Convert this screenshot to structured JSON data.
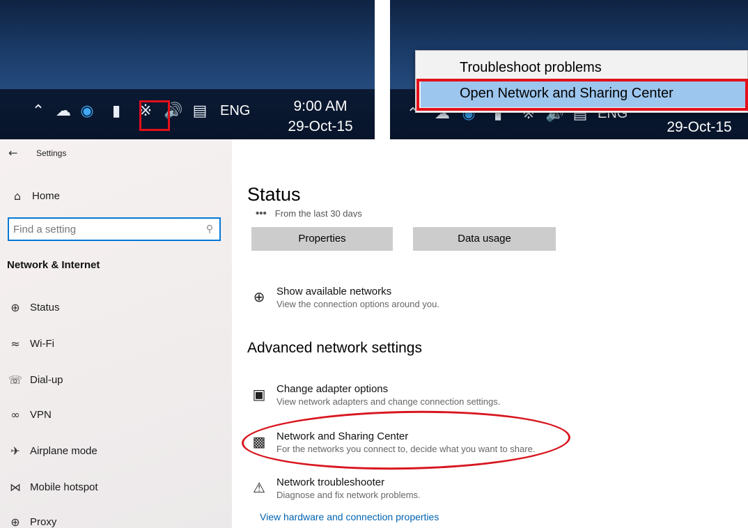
{
  "taskbar": {
    "icons": [
      "chevron-up-icon",
      "cloud-icon",
      "app-circle-icon",
      "battery-icon",
      "wifi-icon",
      "speaker-icon",
      "notification-icon"
    ],
    "language": "ENG",
    "time": "9:00 AM",
    "date": "29-Oct-15",
    "highlight_color": "#e3101a"
  },
  "context_menu": {
    "items": [
      "Troubleshoot problems",
      "Open Network and Sharing Center"
    ],
    "highlighted_color": "#9dc6ee",
    "partial_language": "ENG",
    "partial_date": "29-Oct-15"
  },
  "settings": {
    "window_title": "Settings",
    "home_label": "Home",
    "search_placeholder": "Find a setting",
    "section_title": "Network & Internet",
    "nav_items": [
      {
        "label": "Status",
        "icon": "globe-icon"
      },
      {
        "label": "Wi-Fi",
        "icon": "wifi-icon"
      },
      {
        "label": "Dial-up",
        "icon": "dialup-icon"
      },
      {
        "label": "VPN",
        "icon": "vpn-icon"
      },
      {
        "label": "Airplane mode",
        "icon": "airplane-icon"
      },
      {
        "label": "Mobile hotspot",
        "icon": "hotspot-icon"
      },
      {
        "label": "Proxy",
        "icon": "globe-icon"
      }
    ],
    "page_title": "Status",
    "usage_note": "From the last 30 days",
    "buttons": {
      "properties": "Properties",
      "data_usage": "Data usage"
    },
    "show_networks": {
      "title": "Show available networks",
      "desc": "View the connection options around you."
    },
    "advanced_title": "Advanced network settings",
    "options": [
      {
        "title": "Change adapter options",
        "desc": "View network adapters and change connection settings.",
        "icon": "adapter-monitor-icon"
      },
      {
        "title": "Network and Sharing Center",
        "desc": "For the networks you connect to, decide what you want to share.",
        "icon": "sharing-center-icon"
      },
      {
        "title": "Network troubleshooter",
        "desc": "Diagnose and fix network problems.",
        "icon": "warning-triangle-icon"
      }
    ],
    "view_link": "View hardware and connection properties",
    "accent_color": "#0078d7",
    "annotation_color": "#d8161f"
  }
}
